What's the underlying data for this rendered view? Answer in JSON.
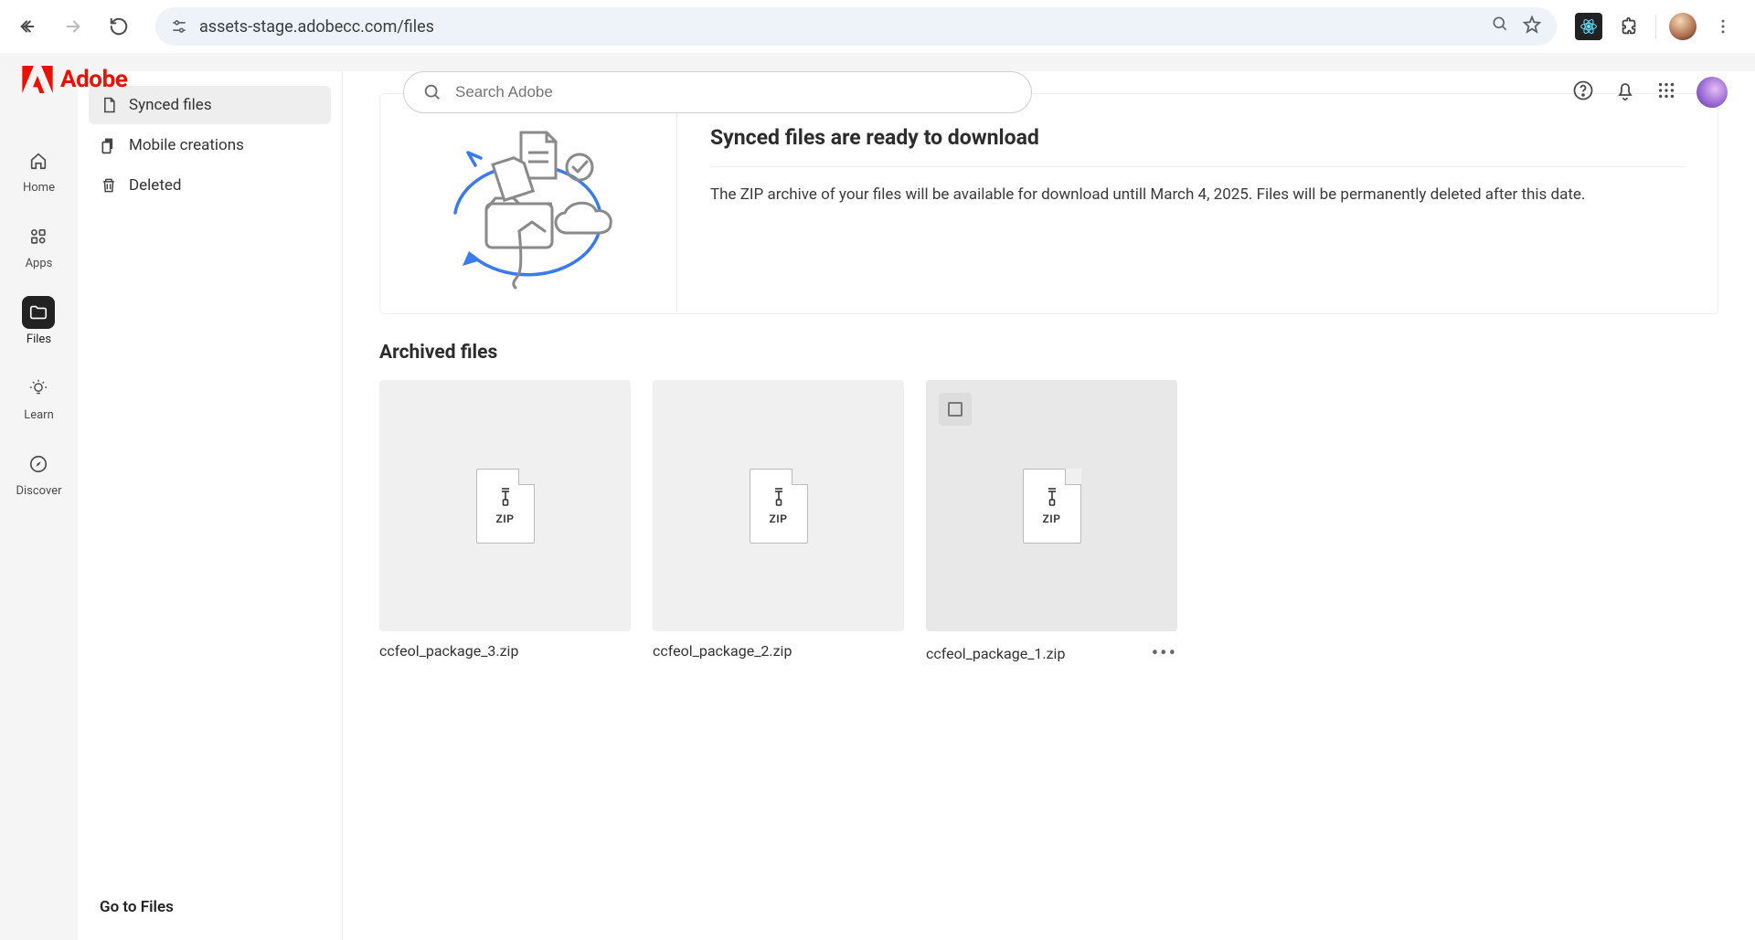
{
  "browser": {
    "url": "assets-stage.adobecc.com/files"
  },
  "brand": {
    "name": "Adobe"
  },
  "search": {
    "placeholder": "Search Adobe"
  },
  "rail": {
    "items": [
      {
        "label": "Home"
      },
      {
        "label": "Apps"
      },
      {
        "label": "Files"
      },
      {
        "label": "Learn"
      },
      {
        "label": "Discover"
      }
    ]
  },
  "sub_sidebar": {
    "items": [
      {
        "label": "Synced files"
      },
      {
        "label": "Mobile creations"
      },
      {
        "label": "Deleted"
      }
    ],
    "goto": "Go to Files"
  },
  "banner": {
    "title": "Synced files are ready to download",
    "body": "The ZIP archive of your files will be available for download untill March 4, 2025. Files will be permanently deleted after this date."
  },
  "section_title": "Archived files",
  "files": [
    {
      "name": "ccfeol_package_3.zip"
    },
    {
      "name": "ccfeol_package_2.zip"
    },
    {
      "name": "ccfeol_package_1.zip"
    }
  ],
  "zip_label": "ZIP"
}
